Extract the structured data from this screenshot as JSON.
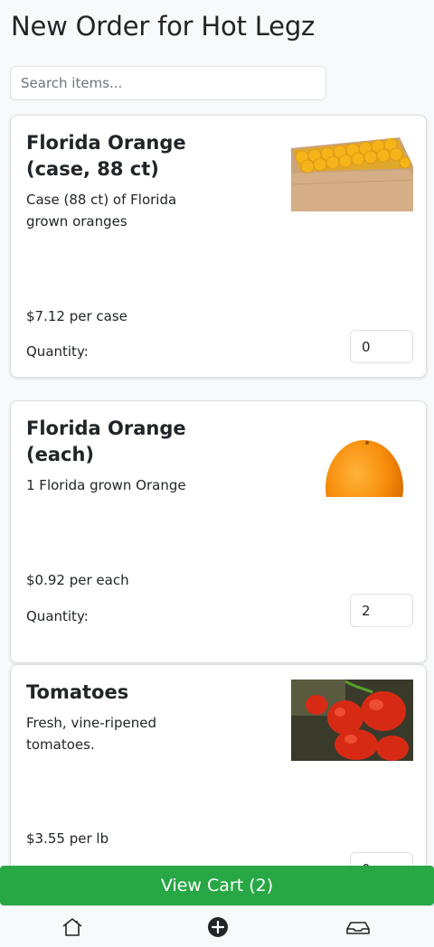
{
  "header": {
    "title": "New Order for Hot Legz"
  },
  "search": {
    "placeholder": "Search items...",
    "value": ""
  },
  "items": [
    {
      "name": "Florida Orange (case, 88 ct)",
      "description": "Case (88 ct) of Florida grown oranges",
      "price": "$7.12 per case",
      "quantity_label": "Quantity:",
      "quantity": "0",
      "image": "orange-case-image"
    },
    {
      "name": "Florida Orange (each)",
      "description": "1 Florida grown Orange",
      "price": "$0.92 per each",
      "quantity_label": "Quantity:",
      "quantity": "2",
      "image": "single-orange-image"
    },
    {
      "name": "Tomatoes",
      "description": "Fresh, vine-ripened tomatoes.",
      "price": "$3.55 per lb",
      "quantity_label": "Quantity:",
      "quantity": "0",
      "image": "tomatoes-image"
    }
  ],
  "cart": {
    "label": "View Cart (2)"
  },
  "nav": {
    "icons": [
      "home-icon",
      "add-circle-icon",
      "inbox-icon"
    ]
  },
  "colors": {
    "accent": "#28a745",
    "page_bg": "#f8f9fa",
    "text": "#212529",
    "muted": "#6c757d"
  }
}
